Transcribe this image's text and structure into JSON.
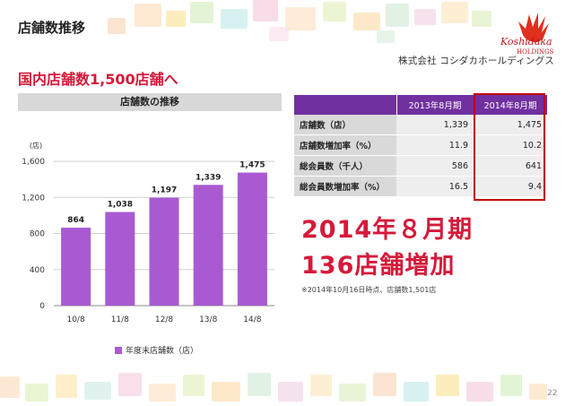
{
  "header": {
    "title": "店舗数推移",
    "company_brand": "Koshidaka",
    "company_brand_sub": "HOLDINGS",
    "company_name": "株式会社 コシダカホールディングス"
  },
  "headline": "国内店舗数1,500店舗へ",
  "chart_data": {
    "type": "bar",
    "title": "店舗数の推移",
    "unit_label": "(店)",
    "categories": [
      "10/8",
      "11/8",
      "12/8",
      "13/8",
      "14/8"
    ],
    "series": [
      {
        "name": "年度末店舗数（店）",
        "values": [
          864,
          1038,
          1197,
          1339,
          1475
        ],
        "color": "#a95ad2"
      }
    ],
    "data_labels": [
      "864",
      "1,038",
      "1,197",
      "1,339",
      "1,475"
    ],
    "ylim": [
      0,
      1600
    ],
    "yticks": [
      0,
      400,
      800,
      1200,
      1600
    ],
    "ytick_labels": [
      "0",
      "400",
      "800",
      "1,200",
      "1,600"
    ],
    "grid": true,
    "legend_position": "bottom"
  },
  "table": {
    "headers": [
      "",
      "2013年8月期",
      "2014年8月期"
    ],
    "rows": [
      {
        "label": "店舗数（店）",
        "v2013": "1,339",
        "v2014": "1,475"
      },
      {
        "label": "店舗数増加率（%）",
        "v2013": "11.9",
        "v2014": "10.2"
      },
      {
        "label": "総会員数（千人）",
        "v2013": "586",
        "v2014": "641"
      },
      {
        "label": "総会員数増加率（%）",
        "v2013": "16.5",
        "v2014": "9.4"
      }
    ]
  },
  "big_text": {
    "line1": "2014年８月期",
    "line2": "136店舗増加"
  },
  "note": "※2014年10月16日時点、店舗数1,501店",
  "page_number": "22",
  "colors": {
    "accent": "#d7193a",
    "bar": "#a95ad2",
    "table_header": "#7030a0",
    "highlight_border": "#c00000"
  }
}
